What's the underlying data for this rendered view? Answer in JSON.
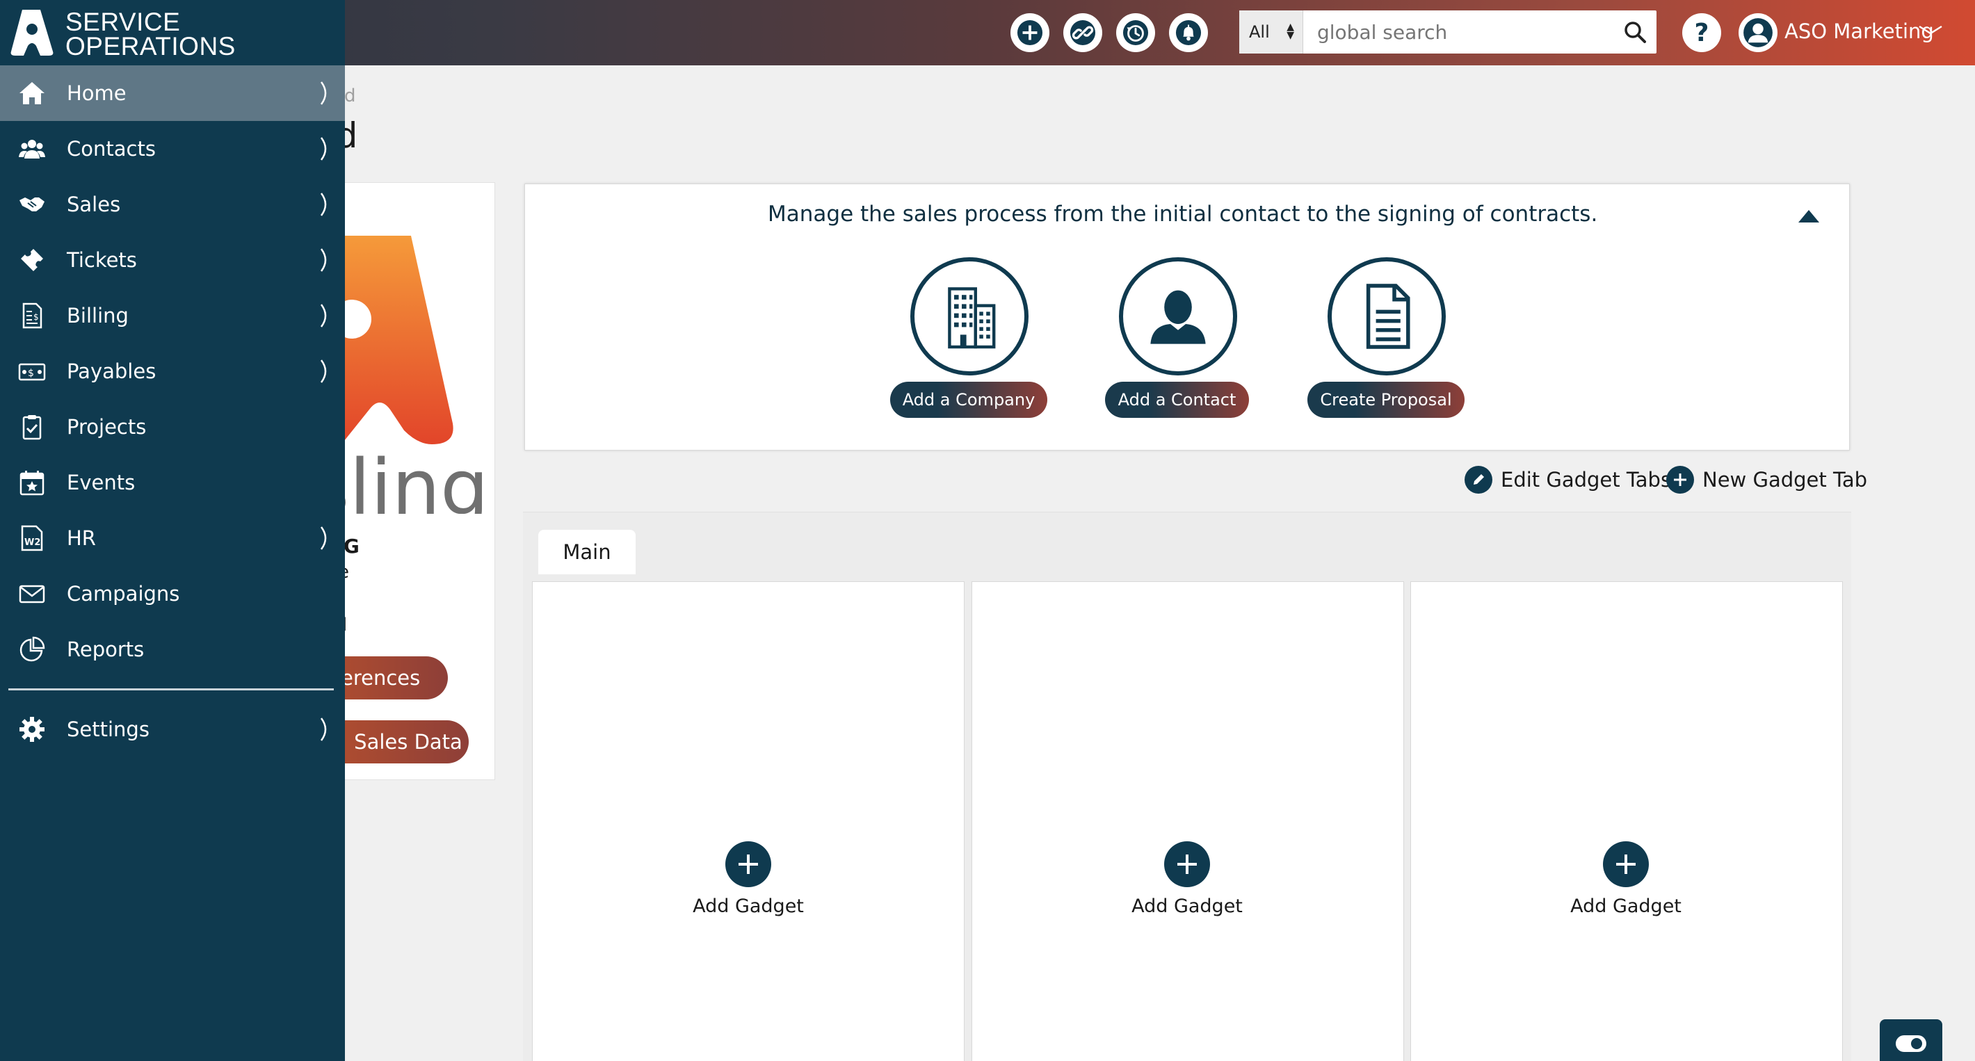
{
  "app": {
    "logo_line1": "SERVICE",
    "logo_line2": "OPERATIONS"
  },
  "topbar": {
    "icons": [
      "add-icon",
      "link-icon",
      "history-icon",
      "bell-icon"
    ],
    "search": {
      "scope_value": "All",
      "placeholder": "global search"
    },
    "help_label": "?",
    "user_name": "ASO Marketing"
  },
  "sidebar": {
    "items": [
      {
        "label": "Home",
        "icon": "home-icon",
        "has_children": true,
        "active": true
      },
      {
        "label": "Contacts",
        "icon": "contacts-icon",
        "has_children": true
      },
      {
        "label": "Sales",
        "icon": "handshake-icon",
        "has_children": true
      },
      {
        "label": "Tickets",
        "icon": "ticket-icon",
        "has_children": true
      },
      {
        "label": "Billing",
        "icon": "billing-icon",
        "has_children": true
      },
      {
        "label": "Payables",
        "icon": "payables-icon",
        "has_children": true
      },
      {
        "label": "Projects",
        "icon": "clipboard-icon",
        "has_children": false
      },
      {
        "label": "Events",
        "icon": "calendar-star-icon",
        "has_children": false
      },
      {
        "label": "HR",
        "icon": "w2-form-icon",
        "has_children": true
      },
      {
        "label": "Campaigns",
        "icon": "envelope-icon",
        "has_children": false
      },
      {
        "label": "Reports",
        "icon": "reports-icon",
        "has_children": false
      }
    ],
    "settings": {
      "label": "Settings",
      "icon": "gear-icon",
      "has_children": true
    }
  },
  "main": {
    "breadcrumb": "hboard",
    "title": "board",
    "company_card": {
      "name": "ING",
      "line1": "e",
      "line2": "l",
      "buttons": [
        "ferences",
        "Sales Data"
      ]
    },
    "intro": {
      "message": "Manage the sales process from the initial contact to the signing of contracts.",
      "actions": [
        {
          "label": "Add a Company",
          "icon": "building-icon"
        },
        {
          "label": "Add a Contact",
          "icon": "person-icon"
        },
        {
          "label": "Create Proposal",
          "icon": "document-icon"
        }
      ]
    },
    "gadget_tabs": {
      "edit_label": "Edit Gadget Tabs",
      "new_label": "New Gadget Tab",
      "tabs": [
        "Main"
      ]
    },
    "gadget_columns": [
      {
        "add_label": "Add Gadget"
      },
      {
        "add_label": "Add Gadget"
      },
      {
        "add_label": "Add Gadget"
      }
    ]
  },
  "colors": {
    "sidebar_bg": "#0f3a4f",
    "sidebar_active": "#5f7786",
    "brand_orange": "#e8552a",
    "button_red": "#8e3f38"
  }
}
